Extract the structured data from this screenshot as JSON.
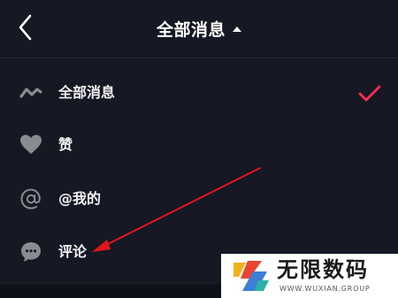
{
  "header": {
    "title": "全部消息",
    "back_icon": "chevron-left-icon",
    "caret_icon": "caret-up-icon"
  },
  "menu": {
    "items": [
      {
        "label": "全部消息",
        "icon": "wave-icon",
        "selected": true
      },
      {
        "label": "赞",
        "icon": "heart-icon",
        "selected": false
      },
      {
        "label": "@我的",
        "icon": "at-icon",
        "selected": false
      },
      {
        "label": "评论",
        "icon": "comment-icon",
        "selected": false
      }
    ],
    "selected_icon": "check-icon"
  },
  "annotation": {
    "arrow_color": "#e0161b"
  },
  "watermark": {
    "title": "无限数码",
    "subtitle": "WWW.WUXIAN.GROUP"
  },
  "colors": {
    "background": "#161823",
    "accent": "#fe2c55",
    "icon_gray": "#8a8b91"
  }
}
